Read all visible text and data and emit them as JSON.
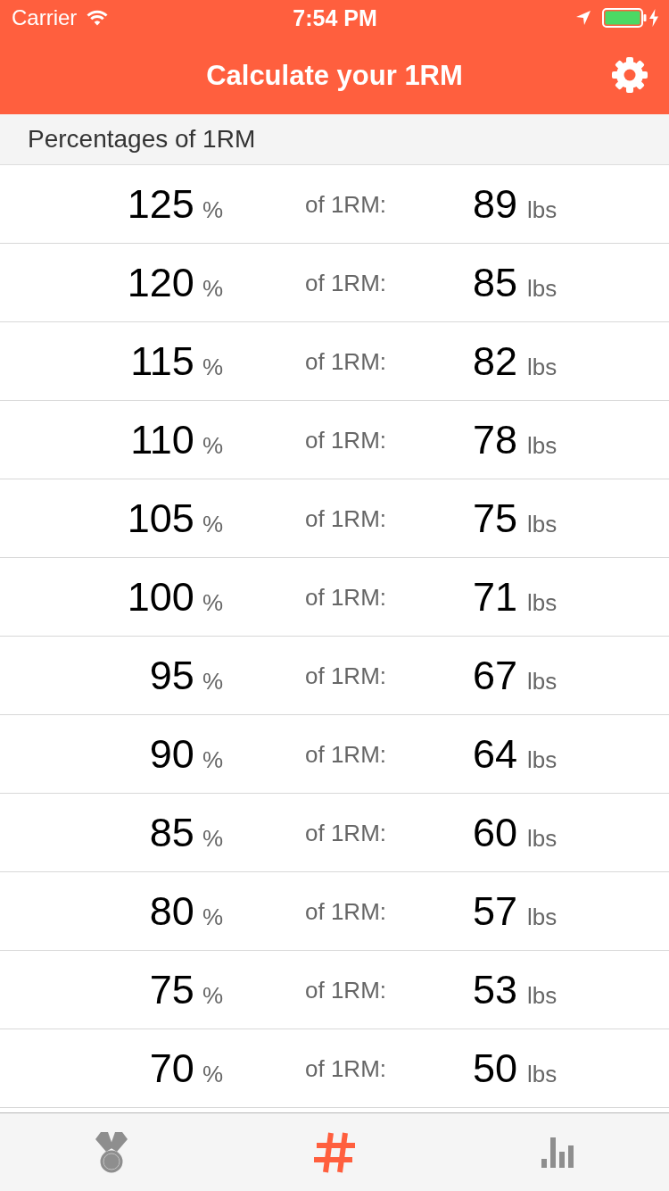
{
  "status_bar": {
    "carrier": "Carrier",
    "time": "7:54 PM"
  },
  "nav_bar": {
    "title": "Calculate your 1RM"
  },
  "section": {
    "title": "Percentages of 1RM"
  },
  "rows": [
    {
      "percent": "125",
      "percent_unit": "%",
      "label": "of 1RM:",
      "weight": "89",
      "weight_unit": "lbs"
    },
    {
      "percent": "120",
      "percent_unit": "%",
      "label": "of 1RM:",
      "weight": "85",
      "weight_unit": "lbs"
    },
    {
      "percent": "115",
      "percent_unit": "%",
      "label": "of 1RM:",
      "weight": "82",
      "weight_unit": "lbs"
    },
    {
      "percent": "110",
      "percent_unit": "%",
      "label": "of 1RM:",
      "weight": "78",
      "weight_unit": "lbs"
    },
    {
      "percent": "105",
      "percent_unit": "%",
      "label": "of 1RM:",
      "weight": "75",
      "weight_unit": "lbs"
    },
    {
      "percent": "100",
      "percent_unit": "%",
      "label": "of 1RM:",
      "weight": "71",
      "weight_unit": "lbs"
    },
    {
      "percent": "95",
      "percent_unit": "%",
      "label": "of 1RM:",
      "weight": "67",
      "weight_unit": "lbs"
    },
    {
      "percent": "90",
      "percent_unit": "%",
      "label": "of 1RM:",
      "weight": "64",
      "weight_unit": "lbs"
    },
    {
      "percent": "85",
      "percent_unit": "%",
      "label": "of 1RM:",
      "weight": "60",
      "weight_unit": "lbs"
    },
    {
      "percent": "80",
      "percent_unit": "%",
      "label": "of 1RM:",
      "weight": "57",
      "weight_unit": "lbs"
    },
    {
      "percent": "75",
      "percent_unit": "%",
      "label": "of 1RM:",
      "weight": "53",
      "weight_unit": "lbs"
    },
    {
      "percent": "70",
      "percent_unit": "%",
      "label": "of 1RM:",
      "weight": "50",
      "weight_unit": "lbs"
    }
  ],
  "tab_bar": {
    "tabs": [
      {
        "selected": false
      },
      {
        "selected": true
      },
      {
        "selected": false
      }
    ]
  }
}
